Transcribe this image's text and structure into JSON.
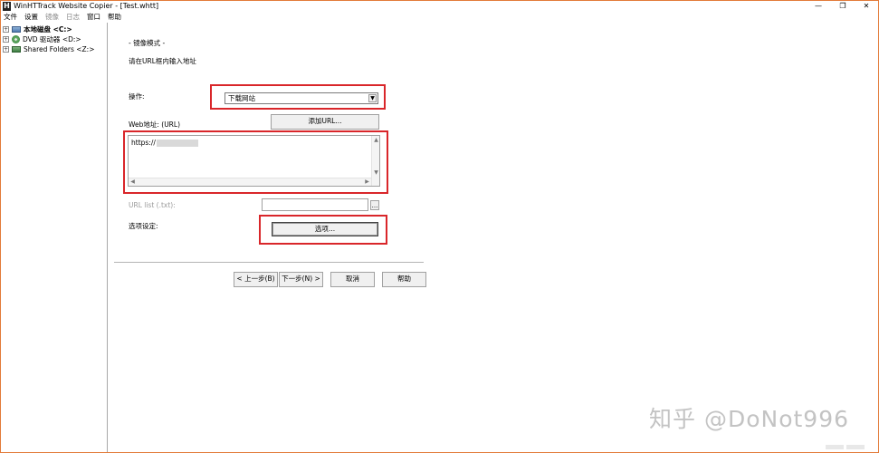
{
  "window": {
    "title": "WinHTTrack Website Copier - [Test.whtt]",
    "controls": {
      "minimize": "—",
      "restore": "❐",
      "close": "✕"
    }
  },
  "menu": [
    {
      "label": "文件",
      "enabled": true
    },
    {
      "label": "设置",
      "enabled": true
    },
    {
      "label": "镜像",
      "enabled": false
    },
    {
      "label": "日志",
      "enabled": false
    },
    {
      "label": "窗口",
      "enabled": true
    },
    {
      "label": "帮助",
      "enabled": true
    }
  ],
  "tree": {
    "items": [
      {
        "label": "本地磁盘 <C:>",
        "icon": "hard-drive-icon",
        "bold": true
      },
      {
        "label": "DVD 驱动器 <D:>",
        "icon": "dvd-drive-icon",
        "bold": false
      },
      {
        "label": "Shared Folders <Z:>",
        "icon": "network-drive-icon",
        "bold": false
      }
    ]
  },
  "main": {
    "mode_label": "- 镜像模式 -",
    "instruction": "请在URL框内输入地址",
    "action_label": "操作:",
    "action_value": "下载网站",
    "add_url_button": "添加URL...",
    "web_address_label": "Web地址: (URL)",
    "url_text": "https://",
    "url_list_label": "URL list (.txt):",
    "url_list_browse": "...",
    "options_label": "选项设定:",
    "options_button": "选项..."
  },
  "nav": {
    "back": "< 上一步(B)",
    "next": "下一步(N) >",
    "cancel": "取消",
    "help": "帮助"
  },
  "watermark": "知乎 @DoNot996",
  "colors": {
    "highlight_box": "#d9262a",
    "window_border": "#e27b3a"
  }
}
